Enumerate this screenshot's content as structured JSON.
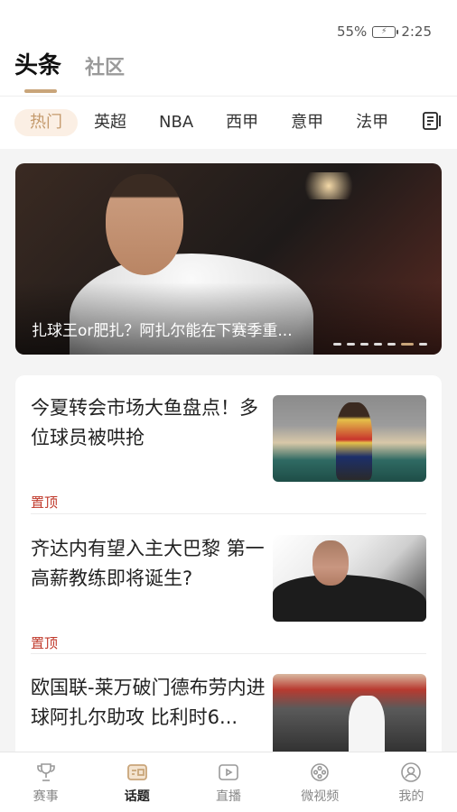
{
  "status": {
    "battery": "55%",
    "time": "2:25"
  },
  "header": {
    "tabs": [
      {
        "label": "头条",
        "active": true
      },
      {
        "label": "社区",
        "active": false
      }
    ]
  },
  "categories": {
    "items": [
      "热门",
      "英超",
      "NBA",
      "西甲",
      "意甲",
      "法甲"
    ],
    "active_index": 0,
    "menu_icon": "list-icon"
  },
  "banner": {
    "caption": "扎球王or肥扎？阿扎尔能在下赛季重...",
    "slide_count": 7,
    "active_slide": 5
  },
  "news": [
    {
      "title": "今夏转会市场大鱼盘点！多位球员被哄抢",
      "tag": "置顶"
    },
    {
      "title": "齐达内有望入主大巴黎 第一高薪教练即将诞生?",
      "tag": "置顶"
    },
    {
      "title": "欧国联-莱万破门德布劳内进球阿扎尔助攻 比利时6...",
      "tag": ""
    }
  ],
  "tabbar": {
    "items": [
      {
        "label": "赛事",
        "icon": "trophy-icon"
      },
      {
        "label": "话题",
        "icon": "topic-icon"
      },
      {
        "label": "直播",
        "icon": "live-icon"
      },
      {
        "label": "微视频",
        "icon": "film-icon"
      },
      {
        "label": "我的",
        "icon": "user-icon"
      }
    ],
    "active_index": 1
  },
  "colors": {
    "accent": "#c9a57a",
    "tag_red": "#c0392b"
  }
}
